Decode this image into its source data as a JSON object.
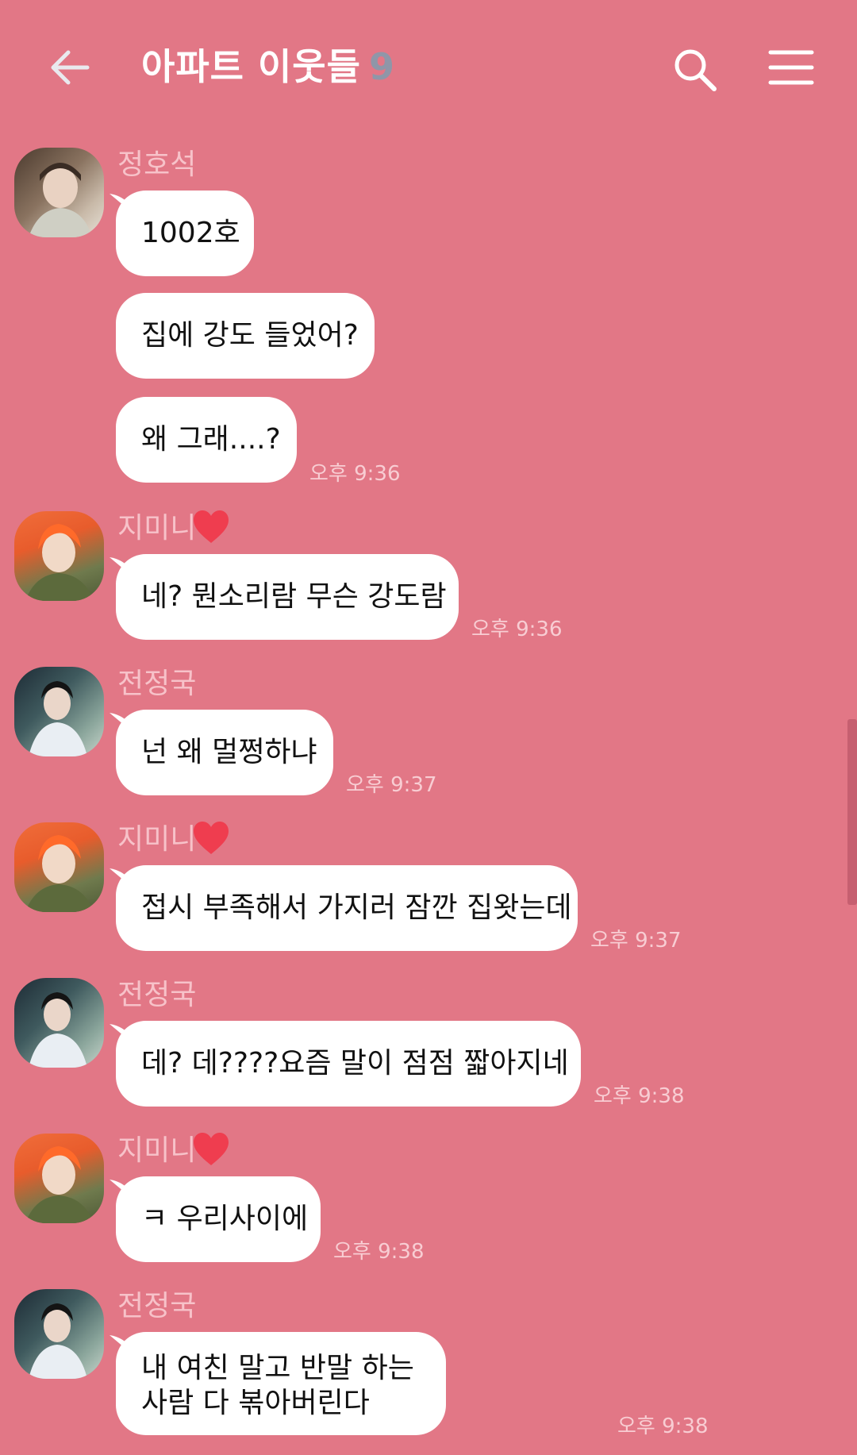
{
  "header": {
    "title": "아파트 이웃들",
    "member_count": "9",
    "icons": {
      "back": "arrow-left-icon",
      "search": "search-icon",
      "menu": "hamburger-menu-icon"
    }
  },
  "colors": {
    "background": "#e27786",
    "bubble": "#ffffff",
    "sender_name": "#f7c2c9",
    "timestamp": "#f8cdd3",
    "member_count": "#8f96a8"
  },
  "messages": [
    {
      "sender": "정호석",
      "heart": false,
      "lines": [
        "1002호",
        "집에 강도 들었어?",
        "왜 그래....?"
      ],
      "time": "오후 9:36"
    },
    {
      "sender": "지미니",
      "heart": true,
      "lines": [
        "네? 뭔소리람 무슨 강도람"
      ],
      "time": "오후 9:36"
    },
    {
      "sender": "전정국",
      "heart": false,
      "lines": [
        "넌 왜 멀쩡하냐"
      ],
      "time": "오후 9:37"
    },
    {
      "sender": "지미니",
      "heart": true,
      "lines": [
        "접시 부족해서 가지러 잠깐 집왓는데"
      ],
      "time": "오후 9:37"
    },
    {
      "sender": "전정국",
      "heart": false,
      "lines": [
        "데? 데????요즘 말이 점점 짧아지네"
      ],
      "time": "오후 9:38"
    },
    {
      "sender": "지미니",
      "heart": true,
      "lines": [
        "ㅋ 우리사이에"
      ],
      "time": "오후 9:38"
    },
    {
      "sender": "전정국",
      "heart": false,
      "lines": [
        "내 여친 말고 반말 하는 사람 다 볶아버린다"
      ],
      "time": "오후 9:38"
    }
  ]
}
